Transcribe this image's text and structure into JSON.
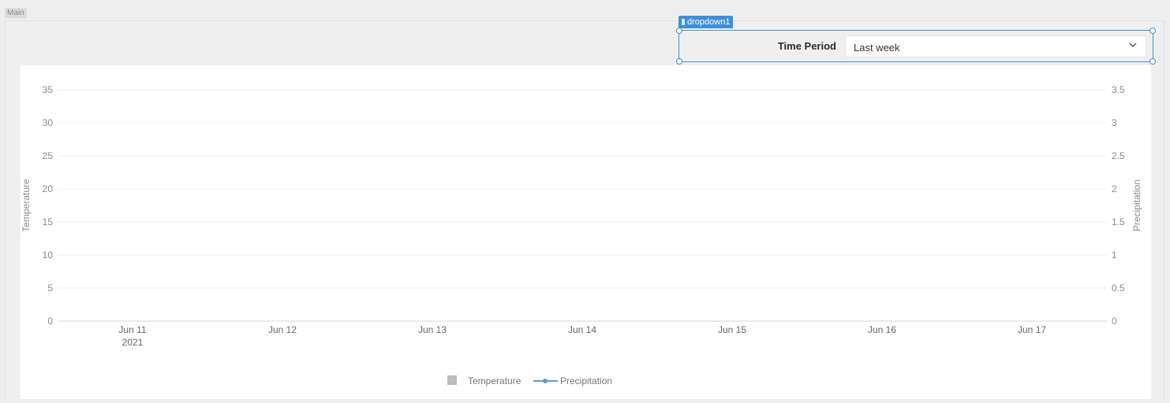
{
  "canvas": {
    "main_label": "Main"
  },
  "selection": {
    "widget_name": "dropdown1"
  },
  "dropdown": {
    "label": "Time Period",
    "value": "Last week"
  },
  "icons": {
    "drag": "drag-handle-icon",
    "chevron": "chevron-down-icon"
  },
  "colors": {
    "accent": "#3f8fd6",
    "temperature": "#bbbbbb",
    "precipitation": "#5b9bd5"
  },
  "chart_data": {
    "type": "bar",
    "title": "",
    "categories": [
      "Jun 11",
      "Jun 12",
      "Jun 13",
      "Jun 14",
      "Jun 15",
      "Jun 16",
      "Jun 17"
    ],
    "x_sublabel": "2021",
    "ylabel": "Temperature",
    "ylabel_right": "Precipitation",
    "ylim": [
      0,
      35
    ],
    "ylim_right": [
      0,
      3.5
    ],
    "yticks": [
      "0",
      "5",
      "10",
      "15",
      "20",
      "25",
      "30",
      "35"
    ],
    "yticks_right": [
      "0",
      "0.5",
      "1",
      "1.5",
      "2",
      "2.5",
      "3",
      "3.5"
    ],
    "grid": true,
    "legend_position": "bottom",
    "series": [
      {
        "name": "Temperature",
        "type": "bar",
        "axis": "left",
        "values": []
      },
      {
        "name": "Precipitation",
        "type": "line",
        "axis": "right",
        "values": []
      }
    ]
  }
}
